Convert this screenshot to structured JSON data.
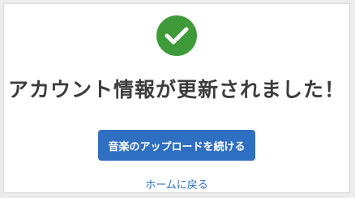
{
  "success": {
    "icon": "check-circle-icon",
    "title": "アカウント情報が更新されました！"
  },
  "actions": {
    "continue_upload_label": "音楽のアップロードを続ける",
    "home_link_label": "ホームに戻る"
  },
  "colors": {
    "success": "#3f9a3a",
    "primary": "#2f6fc2",
    "text": "#3c3c3c"
  }
}
